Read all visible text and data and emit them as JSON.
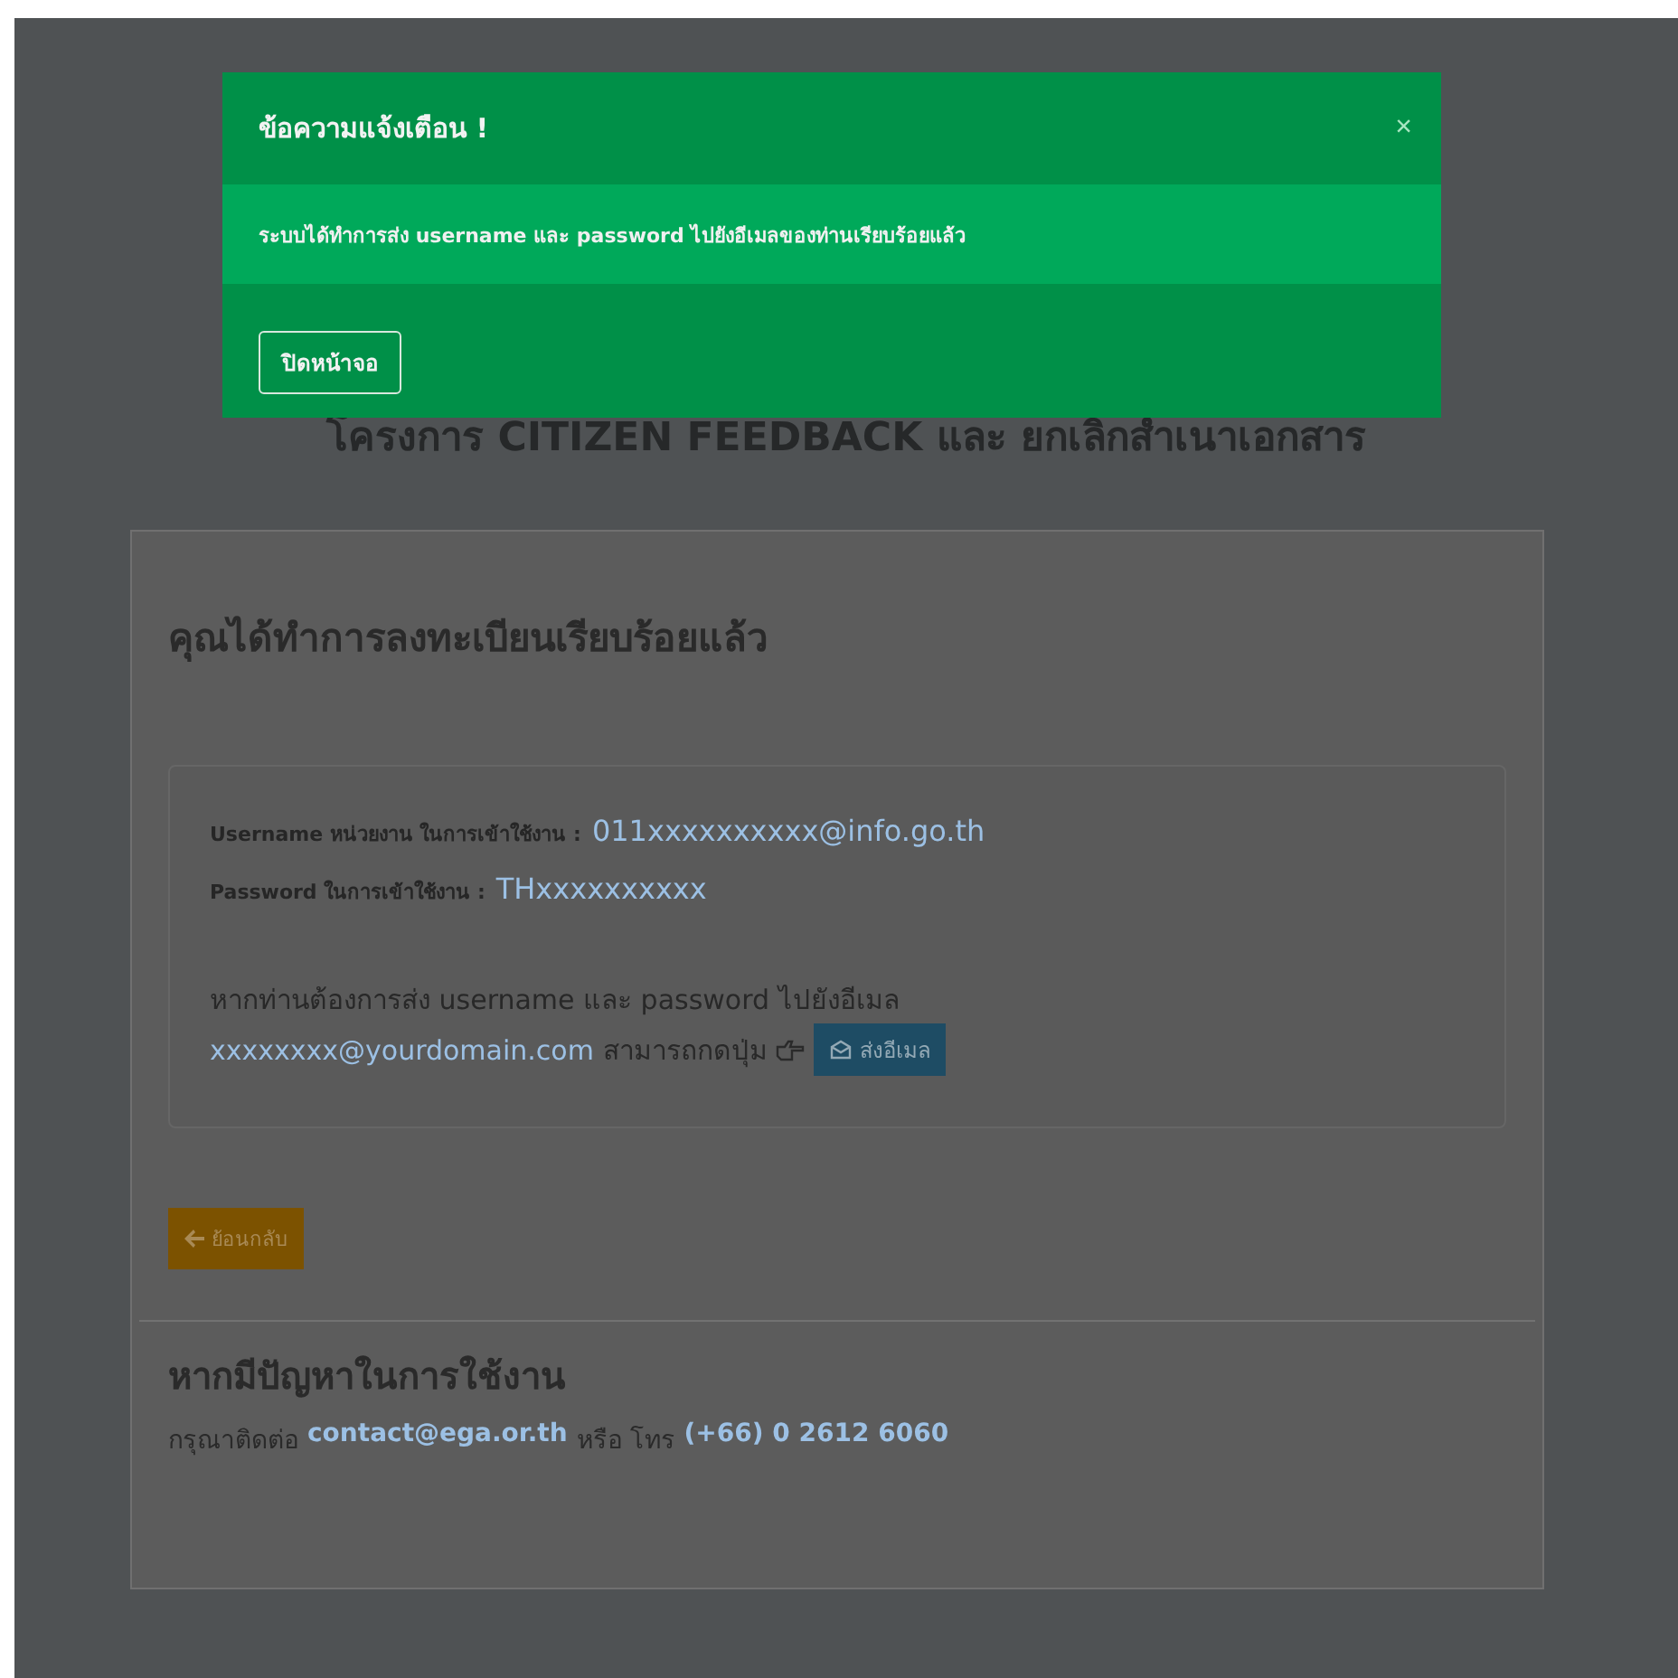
{
  "modal": {
    "title": "ข้อความแจ้งเตือน !",
    "close": "×",
    "message": "ระบบได้ทำการส่ง username และ password ไปยังอีเมลของท่านเรียบร้อยแล้ว",
    "dismiss_button": "ปิดหน้าจอ"
  },
  "page": {
    "title": "โครงการ CITIZEN FEEDBACK และ ยกเลิกสำเนาเอกสาร",
    "card": {
      "heading": "คุณได้ทำการลงทะเบียนเรียบร้อยแล้ว",
      "credentials": [
        {
          "label": "Username หน่วยงาน ในการเข้าใช้งาน :",
          "value": "011xxxxxxxxxx@info.go.th"
        },
        {
          "label": "Password ในการเข้าใช้งาน :",
          "value": "THxxxxxxxxxx"
        }
      ],
      "send_text": "หากท่านต้องการส่ง username และ password ไปยังอีเมล",
      "send_email": "xxxxxxxx@yourdomain.com",
      "send_text_2": "สามารถกดปุ่ม",
      "send_button": "ส่งอีเมล",
      "back_button": "ย้อนกลับ",
      "help_heading": "หากมีปัญหาในการใช้งาน",
      "help_prefix": "กรุณาติดต่อ",
      "help_email": "contact@ega.or.th",
      "help_middle": "หรือ โทร",
      "help_phone": "(+66) 0 2612 6060"
    }
  }
}
